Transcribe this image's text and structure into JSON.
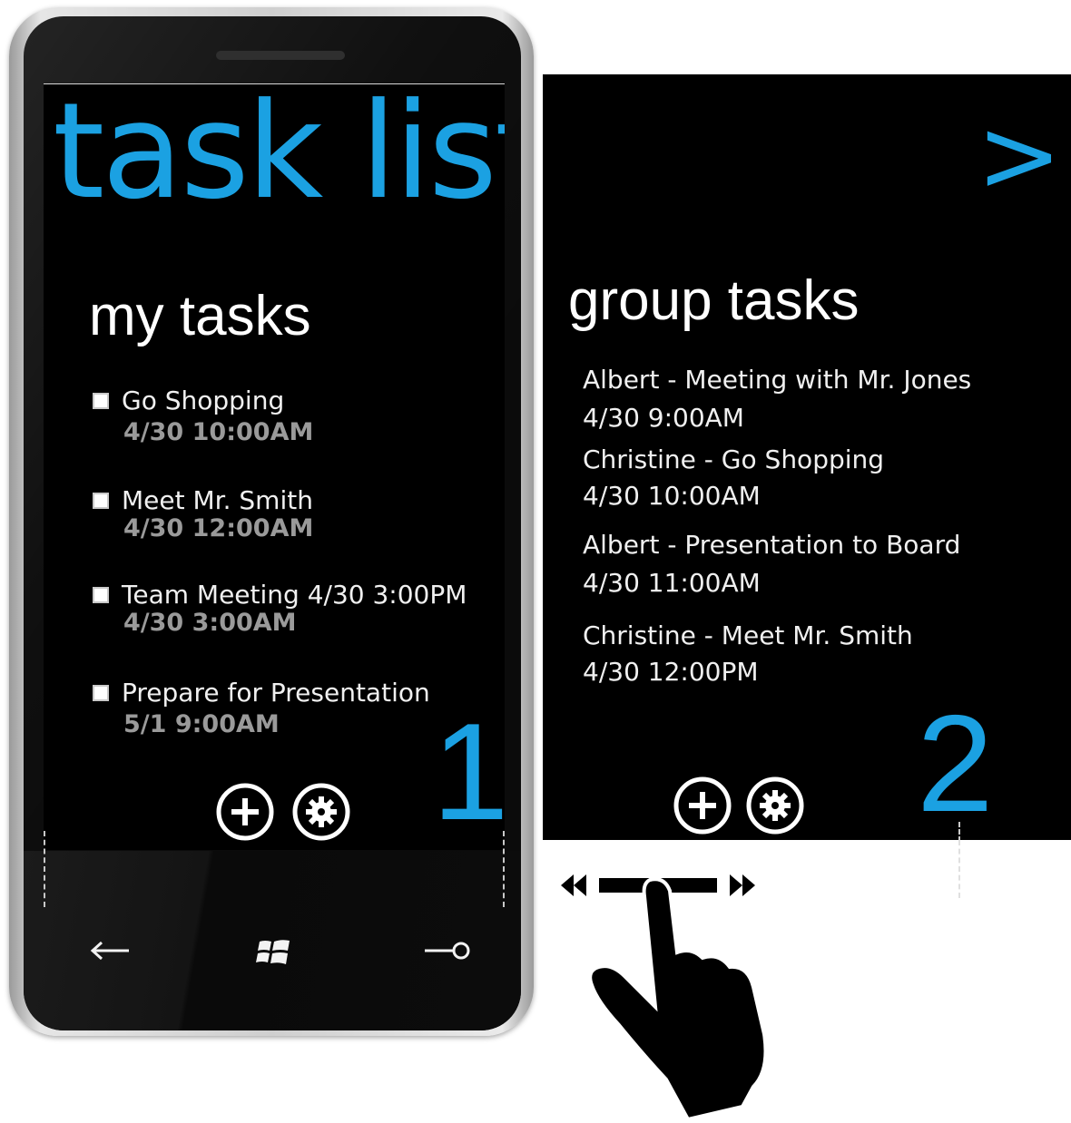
{
  "app": {
    "title": "task list"
  },
  "panel1": {
    "header": "my tasks",
    "number": "1",
    "tasks": [
      {
        "title": "Go Shopping",
        "due": "4/30 10:00AM"
      },
      {
        "title": "Meet Mr. Smith",
        "due": "4/30 12:00AM"
      },
      {
        "title": "Team Meeting 4/30 3:00PM",
        "due": "4/30 3:00AM"
      },
      {
        "title": "Prepare for Presentation",
        "due": "5/1 9:00AM"
      }
    ]
  },
  "panel2": {
    "header": "group tasks",
    "number": "2",
    "chevron": ">",
    "items": [
      {
        "title": "Albert - Meeting with Mr. Jones",
        "time": "4/30 9:00AM"
      },
      {
        "title": "Christine - Go Shopping",
        "time": "4/30 10:00AM"
      },
      {
        "title": "Albert - Presentation to Board",
        "time": "4/30 11:00AM"
      },
      {
        "title": "Christine - Meet Mr. Smith",
        "time": "4/30 12:00PM"
      }
    ]
  },
  "icons": {
    "appbar": [
      "add-icon",
      "settings-icon"
    ],
    "hardware": [
      "back-icon",
      "windows-icon",
      "search-icon"
    ],
    "gesture": [
      "swipe-left-arrow-icon",
      "swipe-bar-icon",
      "swipe-right-arrow-icon",
      "hand-pointer-icon"
    ]
  },
  "colors": {
    "accent": "#1ba1e2",
    "background": "#000000",
    "foreground": "#ffffff",
    "subtle": "#9a9a9a"
  }
}
